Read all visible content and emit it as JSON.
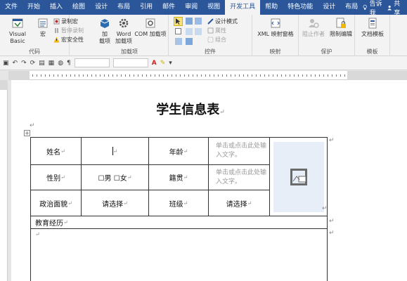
{
  "tabs": [
    "文件",
    "开始",
    "插入",
    "绘图",
    "设计",
    "布局",
    "引用",
    "邮件",
    "审阅",
    "视图",
    "开发工具",
    "帮助",
    "特色功能",
    "设计",
    "布局"
  ],
  "active_tab_index": 10,
  "tell_me": "告诉我",
  "share": "共享",
  "ribbon": {
    "code": {
      "label": "代码",
      "visual_basic": "Visual Basic",
      "macros": "宏",
      "record_macro": "录制宏",
      "pause_recording": "暂停录制",
      "macro_security": "宏安全性"
    },
    "addins": {
      "label": "加载项",
      "addins": "加\n载项",
      "word_addins": "Word\n加载项",
      "com_addins": "COM 加载项"
    },
    "controls": {
      "label": "控件",
      "design_mode": "设计模式",
      "properties": "属性",
      "group": "组合"
    },
    "mapping": {
      "label": "映射",
      "xml_pane": "XML 映射窗格"
    },
    "protect": {
      "label": "保护",
      "block_authors": "阻止作者",
      "restrict_editing": "限制编辑"
    },
    "templates": {
      "label": "模板",
      "doc_template": "文档模板"
    }
  },
  "document": {
    "title": "学生信息表",
    "paragraph_mark": "↵",
    "table_handle": "+",
    "rows": {
      "name_label": "姓名",
      "age_label": "年龄",
      "placeholder_text": "单击或点击此处输入文字。",
      "gender_label": "性别",
      "gender_options": "☐男 ☐女",
      "native_place_label": "籍贯",
      "political_label": "政治面貌",
      "choose_item": "请选择",
      "class_label": "班级",
      "education_label": "教育经历"
    }
  }
}
